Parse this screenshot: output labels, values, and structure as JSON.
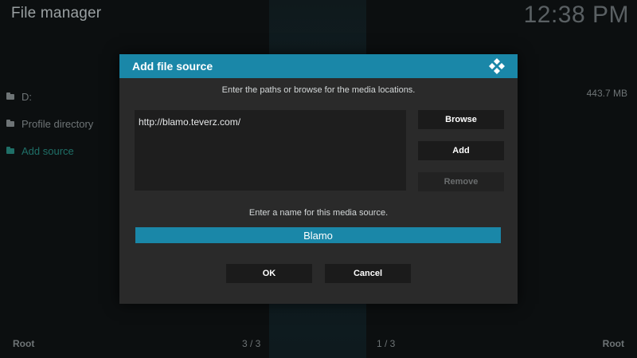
{
  "app": {
    "title": "File manager",
    "clock": "12:38 PM"
  },
  "left_panel": {
    "items": [
      {
        "label": "D:",
        "icon": "folder-icon"
      },
      {
        "label": "Profile directory",
        "icon": "folder-icon"
      },
      {
        "label": "Add source",
        "icon": "folder-icon",
        "active": true
      }
    ],
    "free_space": "443.7 MB"
  },
  "footer": {
    "left_label": "Root",
    "left_counter": "3 / 3",
    "right_counter": "1 / 3",
    "right_label": "Root"
  },
  "dialog": {
    "title": "Add file source",
    "logo_icon": "kodi-logo-icon",
    "paths_instruction": "Enter the paths or browse for the media locations.",
    "paths": [
      "http://blamo.teverz.com/"
    ],
    "browse_label": "Browse",
    "add_label": "Add",
    "remove_label": "Remove",
    "name_instruction": "Enter a name for this media source.",
    "name_value": "Blamo",
    "ok_label": "OK",
    "cancel_label": "Cancel"
  },
  "colors": {
    "accent": "#1a87a8",
    "dialog_bg": "#2a2a2a",
    "active_item": "#1f6f67"
  }
}
